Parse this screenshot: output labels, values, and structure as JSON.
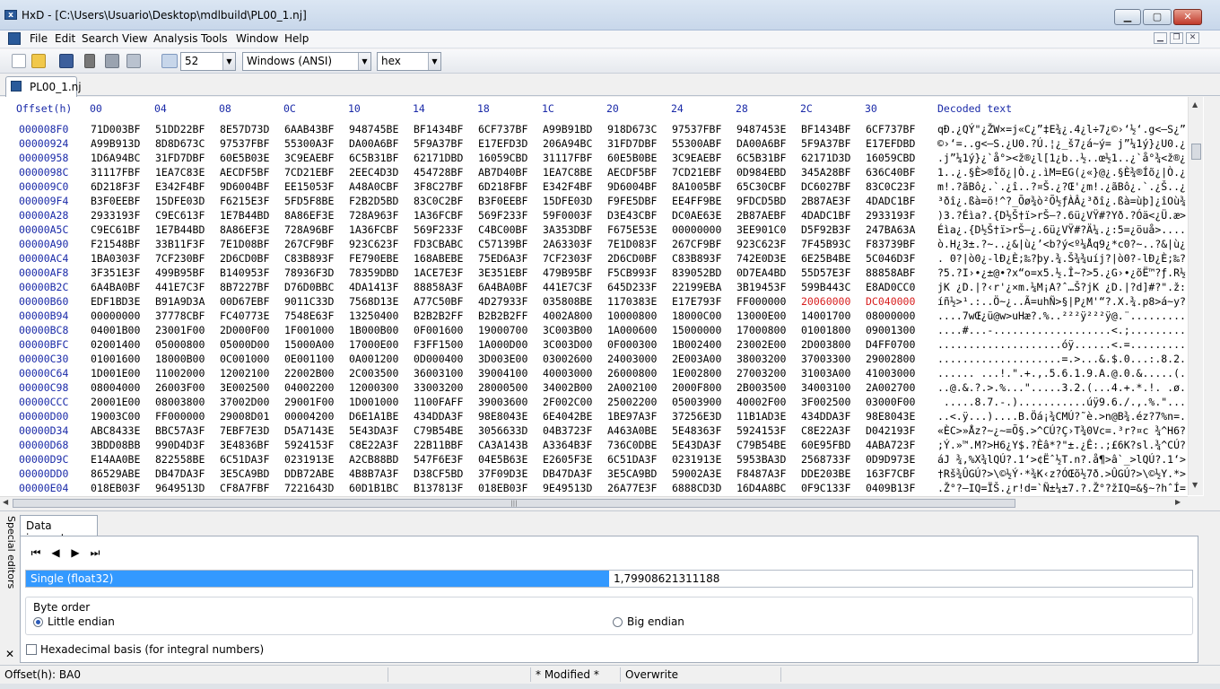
{
  "window": {
    "title": "HxD - [C:\\Users\\Usuario\\Desktop\\mdlbuild\\PL00_1.nj]",
    "app_icon_text": "x",
    "minimize_label": "▁",
    "maximize_label": "▢",
    "close_label": "✕"
  },
  "menu": {
    "items": [
      "File",
      "Edit",
      "Search",
      "View",
      "Analysis",
      "Tools",
      "Window",
      "Help"
    ],
    "mdi_minimize": "▁",
    "mdi_restore": "❐",
    "mdi_close": "✕"
  },
  "toolbar": {
    "bytes_per_row": "52",
    "charset": "Windows (ANSI)",
    "display_mode": "hex",
    "icons": [
      "new-file-icon",
      "open-folder-icon",
      "save-icon",
      "delete-icon",
      "properties-icon",
      "export-icon",
      "bytes-per-row-icon"
    ]
  },
  "tab": {
    "label": "PL00_1.nj"
  },
  "hex": {
    "offset_header": "Offset(h)",
    "column_headers": [
      "00",
      "04",
      "08",
      "0C",
      "10",
      "14",
      "18",
      "1C",
      "20",
      "24",
      "28",
      "2C",
      "30"
    ],
    "decoded_header": "Decoded text",
    "highlight_color": "#d81e1e",
    "rows": [
      {
        "offset": "000008F0",
        "cells": [
          "71D003BF",
          "51DD22BF",
          "8E57D73D",
          "6AAB43BF",
          "948745BE",
          "BF1434BF",
          "6CF737BF",
          "A99B91BD",
          "918D673C",
          "97537FBF",
          "9487453E",
          "BF1434BF",
          "6CF737BF"
        ],
        "decoded": "qÐ.¿QÝ\"¿ŽW×=j«C¿”‡E¾¿.4¿l÷7¿©›‘½‘.g<—S¿”‡E>¿.4¿l÷7¿"
      },
      {
        "offset": "00000924",
        "cells": [
          "A99B913D",
          "8D8D673C",
          "97537FBF",
          "55300A3F",
          "DA00A6BF",
          "5F9A37BF",
          "E17EFD3D",
          "206A94BC",
          "31FD7DBF",
          "55300ABF",
          "DA00A6BF",
          "5F9A37BF",
          "E17EFDBD"
        ],
        "decoded": "©›‘=..g<—S.¿U0.?Ú.¦¿_š7¿á~ý= j”¼1ý}¿U0.¿Ú.¦¿_š7¿á~ý½"
      },
      {
        "offset": "00000958",
        "cells": [
          "1D6A94BC",
          "31FD7DBF",
          "60E5B03E",
          "3C9EAEBF",
          "6C5B31BF",
          "62171DBD",
          "16059CBD",
          "31117FBF",
          "60E5B0BE",
          "3C9EAEBF",
          "6C5B31BF",
          "62171D3D",
          "16059CBD"
        ],
        "decoded": ".j”¼1ý}¿`å°><ž®¿l[1¿b..½..œ½1..¿`å°¾<ž®¿l[1¿b..=..œ½"
      },
      {
        "offset": "0000098C",
        "cells": [
          "31117FBF",
          "1EA7C83E",
          "AECDF5BF",
          "7CD21EBF",
          "2EEC4D3D",
          "454728BF",
          "AB7D40BF",
          "1EA7C8BE",
          "AECDF5BF",
          "7CD21EBF",
          "0D984EBD",
          "345A28BF",
          "636C40BF"
        ],
        "decoded": "1..¿.§È>®Íõ¿|Ò.¿.ìM=EG(¿«}@¿.§È¾®Íõ¿|Ò.¿.˜N½4Z(¿cl@¿"
      },
      {
        "offset": "000009C0",
        "cells": [
          "6D218F3F",
          "E342F4BF",
          "9D6004BF",
          "EE15053F",
          "A48A0CBF",
          "3F8C27BF",
          "6D218FBF",
          "E342F4BF",
          "9D6004BF",
          "8A1005BF",
          "65C30CBF",
          "DC6027BF",
          "83C0C23F"
        ],
        "decoded": "m!.?ãBô¿.`.¿î..?¤Š.¿?Œ'¿m!.¿ãBô¿.`.¿Š..¿eÃ.¿Ü`'¿ƒÀÂ?"
      },
      {
        "offset": "000009F4",
        "cells": [
          "B3F0EEBF",
          "15DFE03D",
          "F6215E3F",
          "5FD5F8BE",
          "F2B2D5BD",
          "83C0C2BF",
          "B3F0EEBF",
          "15DFE03D",
          "F9FE5DBF",
          "EE4FF9BE",
          "9FDCD5BD",
          "2B87AE3F",
          "4DADC1BF"
        ],
        "decoded": "³ðî¿.ßà=ö!^?_Õø¾ò²Õ½ƒÀÂ¿³ðî¿.ßà=ùþ]¿îOù¾ŸÜÕ½+‡®?M­Á¿"
      },
      {
        "offset": "00000A28",
        "cells": [
          "2933193F",
          "C9EC613F",
          "1E7B44BD",
          "8A86EF3E",
          "728A963F",
          "1A36FCBF",
          "569F233F",
          "59F0003F",
          "D3E43CBF",
          "DC0AE63E",
          "2B87AEBF",
          "4DADC1BF",
          "2933193F"
        ],
        "decoded": ")3.?Éìa?.{D½Š†ï>rŠ–?.6ü¿VŸ#?Yð.?Óä<¿Ü.æ>+‡®¿M­Á¿)3.?"
      },
      {
        "offset": "00000A5C",
        "cells": [
          "C9EC61BF",
          "1E7B44BD",
          "8A86EF3E",
          "728A96BF",
          "1A36FCBF",
          "569F233F",
          "C4BC00BF",
          "3A353DBF",
          "F675E53E",
          "00000000",
          "3EE901C0",
          "D5F92B3F",
          "247BA63A"
        ],
        "decoded": "Éìa¿.{D½Š†ï>rŠ–¿.6ü¿VŸ#?Ä¼.¿:5=¿öuå>....>é.ÀÕù+?${¦:"
      },
      {
        "offset": "00000A90",
        "cells": [
          "F21548BF",
          "33B11F3F",
          "7E1D08BF",
          "267CF9BF",
          "923C623F",
          "FD3CBABC",
          "C57139BF",
          "2A63303F",
          "7E1D083F",
          "267CF9BF",
          "923C623F",
          "7F45B93C",
          "F83739BF"
        ],
        "decoded": "ò.H¿3±.?~..¿&|ù¿’<b?ý<º¼Åq9¿*c0?~..?&|ù¿’<b?.E¹<ø79¿"
      },
      {
        "offset": "00000AC4",
        "cells": [
          "1BA0303F",
          "7CF230BF",
          "2D6CD0BF",
          "C83B893F",
          "FE790EBE",
          "168ABEBE",
          "75ED6A3F",
          "7CF2303F",
          "2D6CD0BF",
          "C83B893F",
          "742E0D3E",
          "6E25B4BE",
          "5C046D3F"
        ],
        "decoded": ". 0?|ò0¿-lÐ¿È;‰?þy.¾.Š¾¾uíj?|ò0?-lÐ¿È;‰?t..>n%´¾\\.m?"
      },
      {
        "offset": "00000AF8",
        "cells": [
          "3F351E3F",
          "499B95BF",
          "B140953F",
          "78936F3D",
          "78359DBD",
          "1ACE7E3F",
          "3E351EBF",
          "479B95BF",
          "F5CB993F",
          "839052BD",
          "0D7EA4BD",
          "55D57E3F",
          "88858ABF"
        ],
        "decoded": "?5.?I›•¿±@•?x“o=x5.½.Î~?>5.¿G›•¿õË™?ƒ.R½.~¤½UÕ~?ˆ…Š¿"
      },
      {
        "offset": "00000B2C",
        "cells": [
          "6A4BA0BF",
          "441E7C3F",
          "8B7227BF",
          "D76D0BBC",
          "4DA1413F",
          "88858A3F",
          "6A4BA0BF",
          "441E7C3F",
          "645D233F",
          "22199EBA",
          "3B19453F",
          "599B443C",
          "E8AD0CC0"
        ],
        "decoded": "jK ¿D.|?‹r'¿×m.¼M¡A?ˆ…Š?jK ¿D.|?d]#?\".ž:;.E?Y›D<è­.À"
      },
      {
        "offset": "00000B60",
        "cells": [
          "EDF1BD3E",
          "B91A9D3A",
          "00D67EBF",
          "9011C33D",
          "7568D13E",
          "A77C50BF",
          "4D27933F",
          "035808BE",
          "1170383E",
          "E17E793F",
          "FF000000",
          "20060000",
          "DC040000"
        ],
        "red": [
          11,
          12
        ],
        "decoded": "íñ½>¹.:..Ö~¿..Ã=uhÑ>§|P¿M'“?.X.¾.p8>á~y?ÿ... ...Ü..."
      },
      {
        "offset": "00000B94",
        "cells": [
          "00000000",
          "37778CBF",
          "FC40773E",
          "7548E63F",
          "13250400",
          "B2B2B2FF",
          "B2B2B2FF",
          "4002A800",
          "10000800",
          "18000C00",
          "13000E00",
          "14001700",
          "08000000"
        ],
        "decoded": "....7wŒ¿ü@w>uHæ?.%..²²²ÿ²²²ÿ@.¨.................."
      },
      {
        "offset": "00000BC8",
        "cells": [
          "04001B00",
          "23001F00",
          "2D000F00",
          "1F001000",
          "1B000B00",
          "0F001600",
          "19000700",
          "3C003B00",
          "1A000600",
          "15000000",
          "17000800",
          "01001800",
          "09001300"
        ],
        "decoded": "....#...-...................<.;..................."
      },
      {
        "offset": "00000BFC",
        "cells": [
          "02001400",
          "05000800",
          "05000D00",
          "15000A00",
          "17000E00",
          "F3FF1500",
          "1A000D00",
          "3C003D00",
          "0F000300",
          "1B002400",
          "23002E00",
          "2D003800",
          "D4FF0700"
        ],
        "decoded": "....................óÿ......<.=...........$.#...-.8.Ôÿ.."
      },
      {
        "offset": "00000C30",
        "cells": [
          "01001600",
          "18000B00",
          "0C001000",
          "0E001100",
          "0A001200",
          "0D000400",
          "3D003E00",
          "03002600",
          "24003000",
          "2E003A00",
          "38003200",
          "37003300",
          "29002800"
        ],
        "decoded": "....................=.>...&.$.0...:.8.2.7.3.).(."
      },
      {
        "offset": "00000C64",
        "cells": [
          "1D001E00",
          "11002000",
          "12002100",
          "22002B00",
          "2C003500",
          "36003100",
          "39004100",
          "40003000",
          "26000800",
          "1E002800",
          "27003200",
          "31003A00",
          "41003000"
        ],
        "decoded": "...... ...!.\".+.,.5.6.1.9.A.@.0.&.....(.'.2.1.:.A.0."
      },
      {
        "offset": "00000C98",
        "cells": [
          "08004000",
          "26003F00",
          "3E002500",
          "04002200",
          "12000300",
          "33003200",
          "28000500",
          "34002B00",
          "2A002100",
          "2000F800",
          "2B003500",
          "34003100",
          "2A002700"
        ],
        "decoded": "..@.&.?.>.%...\".....3.2.(...4.+.*.!. .ø.+.5.4.1.*.'."
      },
      {
        "offset": "00000CCC",
        "cells": [
          "20001E00",
          "08003800",
          "37002D00",
          "29001F00",
          "1D001000",
          "1100FAFF",
          "39003600",
          "2F002C00",
          "25002200",
          "05003900",
          "40002F00",
          "3F002500",
          "03000F00"
        ],
        "decoded": " .....8.7.-.)...........úÿ9.6./.,.%.\"...9.@./.?.%...."
      },
      {
        "offset": "00000D00",
        "cells": [
          "19003C00",
          "FF000000",
          "29008D01",
          "00004200",
          "D6E1A1BE",
          "434DDA3F",
          "98E8043E",
          "6E4042BE",
          "1BE97A3F",
          "37256E3D",
          "11B1AD3E",
          "434DDA3F",
          "98E8043E"
        ],
        "decoded": "..<.ÿ...)....B.Öá¡¾CMÚ?˜è.>n@B¾.éz?7%n=.±­>CMÚ?˜è.>"
      },
      {
        "offset": "00000D34",
        "cells": [
          "ABC8433E",
          "BBC57A3F",
          "7EBF7E3D",
          "D5A7143E",
          "5E43DA3F",
          "C79B54BE",
          "3056633D",
          "04B3723F",
          "A463A0BE",
          "5E48363F",
          "5924153F",
          "C8E22A3F",
          "D042193F"
        ],
        "decoded": "«ÈC>»Åz?~¿~=Õ§.>^CÚ?Ç›T¾0Vc=.³r?¤c ¾^H6?Y$.?Èâ*?ÐB.?"
      },
      {
        "offset": "00000D68",
        "cells": [
          "3BDD08BB",
          "990D4D3F",
          "3E4836BF",
          "5924153F",
          "C8E22A3F",
          "22B11BBF",
          "CA3A143B",
          "A3364B3F",
          "736C0DBE",
          "5E43DA3F",
          "C79B54BE",
          "60E95FBD",
          "4ABA723F"
        ],
        "decoded": ";Ý.»™.M?>H6¿Y$.?Èâ*?\"±.¿Ê:.;£6K?sl.¾^CÚ?Ç›T¾`é_½Jºr?"
      },
      {
        "offset": "00000D9C",
        "cells": [
          "E14AA0BE",
          "822558BE",
          "6C51DA3F",
          "0231913E",
          "A2CB88BD",
          "547F6E3F",
          "04E5B63E",
          "E2605F3E",
          "6C51DA3F",
          "0231913E",
          "5953BA3D",
          "2568733F",
          "0D9D973E"
        ],
        "decoded": "áJ ¾‚%X¾lQÚ?.1‘>¢Ëˆ½T.n?.å¶>â`_>lQÚ?.1‘>YSº=%hs?..—>"
      },
      {
        "offset": "00000DD0",
        "cells": [
          "86529ABE",
          "DB47DA3F",
          "3E5CA9BD",
          "DDB72ABE",
          "4B8B7A3F",
          "D38CF5BD",
          "37F09D3E",
          "DB47DA3F",
          "3E5CA9BD",
          "59002A3E",
          "F8487A3F",
          "DDE203BE",
          "163F7CBF"
        ],
        "decoded": "†Rš¾ÛGÚ?>\\©½Ý·*¾K‹z?ÓŒõ½7ð.>ÛGÚ?>\\©½Y.*>øHz?Ýâ.¾.?|¿"
      },
      {
        "offset": "00000E04",
        "cells": [
          "018EB03F",
          "9649513D",
          "CF8A7FBF",
          "7221643D",
          "60D1B1BC",
          "B137813F",
          "018EB03F",
          "9E49513D",
          "26A77E3F",
          "6888CD3D",
          "16D4A8BC",
          "0F9C133F",
          "0409B13F"
        ],
        "decoded": ".Ž°?–IQ=ÏŠ.¿r!d=`Ñ±¼±7.?.Ž°?žIQ=&§~?hˆÍ=.Ô¨¼.œ.?..±?"
      }
    ]
  },
  "bottom": {
    "side_label": "Special editors",
    "close_label": "✕",
    "inspector_tab": "Data inspector",
    "nav": [
      "⏮",
      "◀",
      "▶",
      "⏭"
    ],
    "type": "Single (float32)",
    "value": "1,79908621311188",
    "byte_order_label": "Byte order",
    "little_endian": "Little endian",
    "big_endian": "Big endian",
    "hex_basis": "Hexadecimal basis (for integral numbers)"
  },
  "status": {
    "offset": "Offset(h): BA0",
    "modified": "* Modified *",
    "mode": "Overwrite"
  }
}
